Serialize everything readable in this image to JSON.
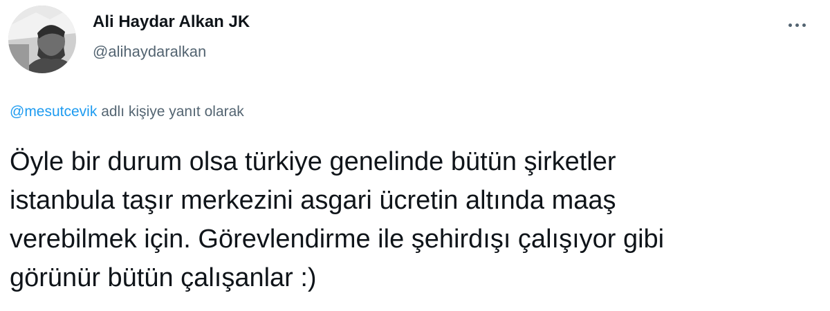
{
  "tweet": {
    "author": {
      "display_name": "Ali Haydar Alkan JK",
      "handle": "@alihaydaralkan",
      "avatar_icon": "user-avatar-photo"
    },
    "more_icon": "more-horizontal-icon",
    "reply_context": {
      "mention": "@mesutcevik",
      "suffix": " adlı kişiye yanıt olarak"
    },
    "text": "Öyle bir durum olsa türkiye genelinde bütün şirketler\nistanbula taşır merkezini asgari ücretin altında maaş\nverebilmek için. Görevlendirme ile şehirdışı çalışıyor gibi\ngörünür bütün çalışanlar :)"
  },
  "colors": {
    "text_primary": "#0f1419",
    "text_secondary": "#536471",
    "link": "#1d9bf0",
    "background": "#ffffff"
  }
}
